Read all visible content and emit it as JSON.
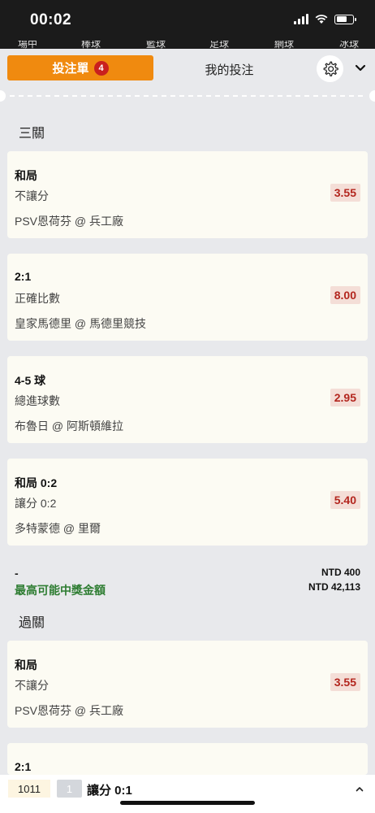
{
  "status_bar": {
    "time": "00:02"
  },
  "sport_tabs": [
    "場中",
    "棒球",
    "籃球",
    "足球",
    "網球",
    "冰球"
  ],
  "header": {
    "slip_label": "投注單",
    "slip_count": "4",
    "my_bets_label": "我的投注"
  },
  "sections": {
    "singles_title": "三關",
    "parlay_title": "過關"
  },
  "bets": [
    {
      "selection": "和局",
      "market": "不讓分",
      "match": "PSV恩荷芬 @ 兵工廠",
      "odds": "3.55"
    },
    {
      "selection": "2:1",
      "market": "正確比數",
      "match": "皇家馬德里 @ 馬德里競技",
      "odds": "8.00"
    },
    {
      "selection": "4-5 球",
      "market": "總進球數",
      "match": "布魯日 @ 阿斯頓維拉",
      "odds": "2.95"
    },
    {
      "selection": "和局 0:2",
      "market": "讓分 0:2",
      "match": "多特蒙德 @ 里爾",
      "odds": "5.40"
    }
  ],
  "summary": {
    "dash": "-",
    "max_win_label": "最高可能中獎金額",
    "stake": "NTD 400",
    "max_win": "NTD 42,113"
  },
  "parlay_bets": [
    {
      "selection": "和局",
      "market": "不讓分",
      "match": "PSV恩荷芬 @ 兵工廠",
      "odds": "3.55"
    },
    {
      "selection": "2:1"
    }
  ],
  "bottom_bar": {
    "code": "1011",
    "number": "1",
    "label": "讓分 0:1"
  },
  "colors": {
    "accent": "#f08a0f",
    "badge_red": "#c9201e",
    "odds_text": "#b3261e",
    "win_green": "#2e7d32"
  },
  "icons": [
    "signal-icon",
    "wifi-icon",
    "battery-icon",
    "gear-icon",
    "chevron-down-icon",
    "chevron-up-icon"
  ]
}
